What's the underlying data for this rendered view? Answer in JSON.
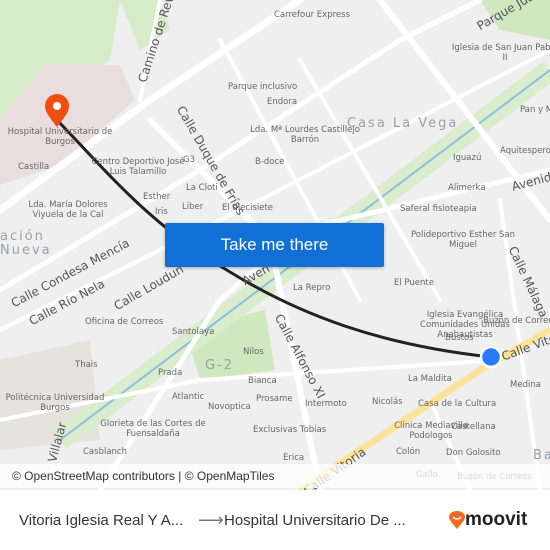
{
  "map": {
    "area_labels": [
      "Casa La Vega",
      "ación",
      "Nueva",
      "G-2",
      "Ba"
    ],
    "street_labels": [
      "Camino de Rev",
      "Calle Duque de Frías",
      "Parque Juan Pablo",
      "Avenid",
      "Calle Málaga",
      "Calle Condesa Mencía",
      "Calle Río Nela",
      "Calle Loudun",
      "Aven",
      "Calle Alfonso XI",
      "Calle Vitoria",
      "Calle Vitoria",
      "Villalar"
    ],
    "poi_labels": [
      "Carrefour Express",
      "Iglesia de San Juan Pablo II",
      "Parque inclusivo",
      "Endora",
      "Pan y Más",
      "Lda. Mª Lourdes Castillejo Barrón",
      "G3",
      "B-doce",
      "Aquitespero",
      "Iguazú",
      "Centro Deportivo José Luis Talamillo",
      "Castilla",
      "Esther",
      "La Cloti",
      "Alimerka",
      "Iris",
      "Liber",
      "El diecisiete",
      "Saferal fisioteapia",
      "Lda. María Dolores Viyuela de la Cal",
      "Polideportivo Esther San Miguel",
      "La Repro",
      "El Puente",
      "Iglesia Evangélica Comunidades Unidas Anabautistas",
      "Oficina de Correos",
      "Santolaya",
      "Buzón de Correos",
      "Bustos",
      "Nilos",
      "Thais",
      "Prada",
      "Bianca",
      "La Maldita",
      "Medina",
      "Atlantic",
      "Prosame",
      "Novopticа",
      "Intermoto",
      "Nicolás",
      "Casa de la Cultura",
      "Politécnica Universidad Burgos",
      "Glorieta de las Cortes de Fuensaldaña",
      "Exclusivas Tobías",
      "Clínica Mediavilla Podologos",
      "Castellana",
      "Casblanch",
      "Erica",
      "Colón",
      "Don Golosito",
      "Gallo",
      "Buzón de Correos",
      "Hospital Universitario de Burgos"
    ],
    "destination_marker_icon": "map-pin-icon",
    "origin_marker_icon": "location-dot-icon",
    "colors": {
      "route": "#222222",
      "destination": "#f04e10",
      "origin": "#2979ff",
      "park": "#cfe8bf",
      "river": "#7fb3dd",
      "main_road": "#fbe49a"
    }
  },
  "cta": {
    "label": "Take me there",
    "color": "#1070d6"
  },
  "attribution": "© OpenStreetMap contributors | © OpenMapTiles",
  "footer": {
    "from": "Vitoria Iglesia Real Y A...",
    "arrow": "⟶",
    "to": "Hospital Universitario De ...",
    "brand": "moovit",
    "brand_color": "#f26a21"
  }
}
